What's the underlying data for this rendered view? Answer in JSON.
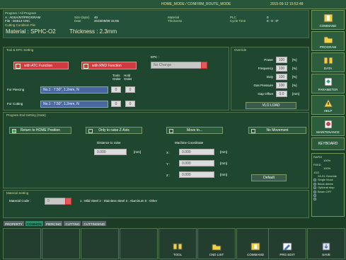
{
  "titlebar": {
    "mode": "HOME_MODE / CONFIRM_ROUTE_MODE",
    "datetime": "2015-09-12  15:52:48"
  },
  "header": {
    "program_label": "Program / All Program",
    "program_value": "A : ADSA/NT/PROGRAM",
    "file_value": "File : D6514-CNC",
    "size_label": "Size (byte)",
    "size_value": "40",
    "date_label": "Date",
    "date_value": "2015/09/09  15:06",
    "material_label": "Material",
    "thickness_label": "Thickness",
    "plc_label": "PLC",
    "plc_value": "0",
    "cycle_label": "Cycle Time",
    "cycle_value": "0 : 0 : 0*",
    "cutting_label": "Cutting Condition File",
    "material_text": "Material : SPHC-O2",
    "thickness_text": "Thickness : 2.3mm"
  },
  "tool": {
    "title": "Tool & EPC Setting",
    "atc_label": "with ATC Function",
    "rnd_label": "with RND Function",
    "epc_label": "EPC :",
    "epc_value": "No Change",
    "tools_hdr": "Tools",
    "hold_hdr": "Hold",
    "order_hdr": "Order",
    "order_hdr2": "Order",
    "piercing_label": "For Piercing",
    "piercing_tool": "No.1 : 7.50\", 1.2mm, N",
    "piercing_a": "0",
    "piercing_b": "0",
    "cutting_label": "For Cutting",
    "cutting_tool": "No.1 : 7.50\", 1.2mm, N",
    "cutting_a": "0",
    "cutting_b": "0"
  },
  "override": {
    "title": "Override",
    "rows": [
      {
        "label": "Power",
        "value": "100",
        "unit": "[%]"
      },
      {
        "label": "Frequency",
        "value": "100",
        "unit": "[%]"
      },
      {
        "label": "Duty",
        "value": "100",
        "unit": "[%]"
      },
      {
        "label": "Gas Pressure",
        "value": "100",
        "unit": "[%]"
      },
      {
        "label": "Gap Offset",
        "value": "0.0",
        "unit": "[mm]"
      }
    ],
    "vlo_load": "VLO LOAD"
  },
  "end": {
    "title": "Program End Setting (Gate)",
    "opt1": "Return to HOME Position",
    "opt2": "Only to raise Z-Axis",
    "opt3": "Move to...",
    "opt4": "No Movement",
    "raise_label": "Distance to raise",
    "raise_value": "0.000",
    "raise_unit": "[mm]",
    "mc_label": "Machine Coordinate",
    "x_label": "X :",
    "x_value": "0.000",
    "x_unit": "[mm]",
    "y_label": "Y :",
    "y_value": "0.000",
    "y_unit": "[mm]",
    "z_label": "Z :",
    "z_value": "0.000",
    "z_unit": "[mm]",
    "default_btn": "Default"
  },
  "material": {
    "title": "Material Setting",
    "code_label": "Material Code :",
    "code_value": "0",
    "legend": "1 : Mild Steel     2 : Stainless Steel     3 : Aluminum     0 : Other"
  },
  "tabs": [
    "PROPERTY",
    "COMMON",
    "PIERCING",
    "CUTTING",
    "CUTTINGEND"
  ],
  "right_menu": [
    "COMMAND",
    "PROGRAM",
    "DATA",
    "PARAMETER",
    "HELP",
    "MAINTENANCE"
  ],
  "keyboard": "KEYBOARD",
  "status": {
    "lines": [
      "RAPID",
      "100%",
      "FEED",
      "100%",
      "JOG",
      "X0.01 Override"
    ],
    "radios": [
      "Single block",
      "Block delete",
      "Optional stop",
      "Beam OFF",
      "",
      ""
    ]
  },
  "bottom": {
    "tool": "TOOL",
    "cnd": "CND LIST",
    "command": "COMMAND",
    "prg": "PRG EDIT",
    "save": "SAVE"
  }
}
